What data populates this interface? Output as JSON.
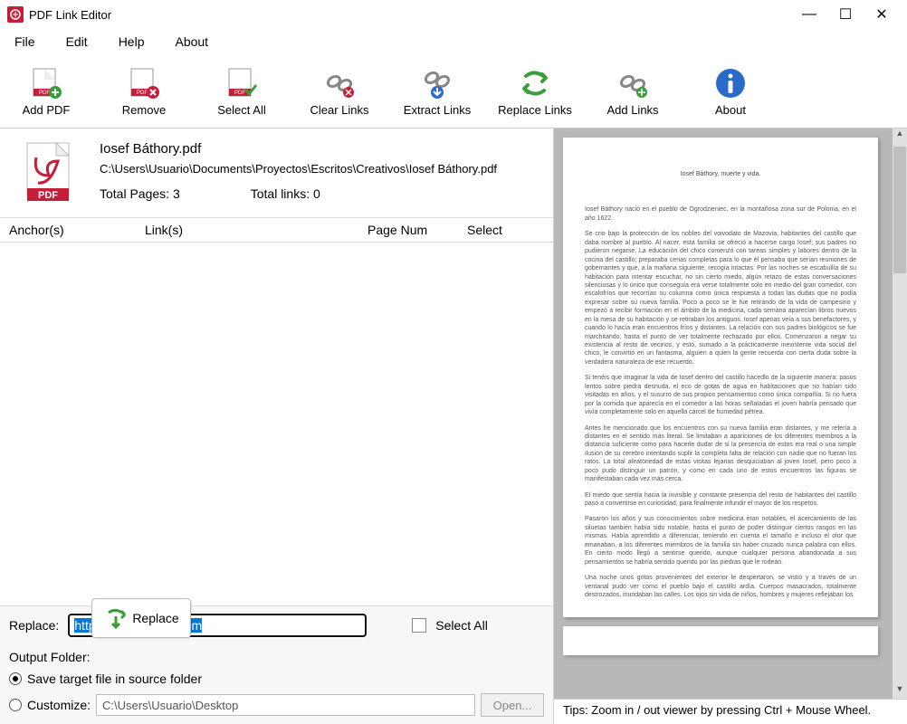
{
  "window": {
    "title": "PDF Link Editor"
  },
  "menu": {
    "file": "File",
    "edit": "Edit",
    "help": "Help",
    "about": "About"
  },
  "toolbar": {
    "add_pdf": "Add PDF",
    "remove": "Remove",
    "select_all": "Select All",
    "clear_links": "Clear Links",
    "extract_links": "Extract Links",
    "replace_links": "Replace Links",
    "add_links": "Add Links",
    "about": "About"
  },
  "file": {
    "name": "Iosef Báthory.pdf",
    "path": "C:\\Users\\Usuario\\Documents\\Proyectos\\Escritos\\Creativos\\Iosef Báthory.pdf",
    "total_pages": "Total Pages: 3",
    "total_links": "Total links: 0"
  },
  "table": {
    "anchor": "Anchor(s)",
    "link": "Link(s)",
    "page_num": "Page Num",
    "select": "Select"
  },
  "replace": {
    "label": "Replace:",
    "value": "http://www.google.com",
    "select_all": "Select All",
    "button": "Replace"
  },
  "output": {
    "label": "Output Folder:",
    "source": "Save target file in source folder",
    "customize": "Customize:",
    "custom_path": "C:\\Users\\Usuario\\Desktop",
    "open": "Open..."
  },
  "preview": {
    "title": "Iosef Báthory, muerte y vida.",
    "p1": "Iosef Báthory nació en el pueblo de Ogrodzieniec, en la montañosa zona sur de Polonia, en el año 1622.",
    "p2": "Se crio bajo la protección de los nobles del voivodato de Mazovia, habitantes del castillo que daba nombre al pueblo. Al nacer, esta familia se ofreció a hacerse cargo Iosef; sus padres no pudieron negarse. La educación del chico comenzó con tareas simples y labores dentro de la cocina del castillo; preparaba cenas completas para lo que él pensaba que serían reuniones de gobernantes y que, a la mañana siguiente, recogía intactas. Por las noches se escabullía de su habitación para intentar escuchar, no sin cierto miedo, algún retazo de estas conversaciones silenciosas y lo único que conseguía era verse totalmente solo en medio del gran comedor, con escalofríos que recorrían su columna como única respuesta a todas las dudas que no podía expresar sobre su nueva familia. Poco a poco se le fue retirando de la vida de campesino y empezó a recibir formación en el ámbito de la medicina, cada semana aparecían libros nuevos en la mesa de su habitación y se retiraban los antiguos. Iosef apenas veía a sus benefactores, y cuando lo hacía eran encuentros fríos y distantes. La relación con sus padres biológicos se fue marchitando, hasta el punto de ver totalmente rechazado por ellos. Comenzaron a negar su existencia al resto de vecinos, y esto, sumado a la prácticamente inexistente vida social del chico, le convirtió en un fantasma, alguien a quien la gente recuerda con cierta duda sobre la verdadera naturaleza de ese recuerdo.",
    "p3": "Si tenéis que imaginar la vida de Iosef dentro del castillo hacedlo de la siguiente manera: pasos lentos sobre piedra desnuda, el eco de gotas de agua en habitaciones que no habían sido visitadas en años, y el susurro de sus propios pensamientos como única compañía. Si no fuera por la comida que aparecía en el comedor a las horas señaladas el joven habría pensado que vivía completamente solo en aquella cárcel de humedad pétrea.",
    "p4": "Antes he mencionado que los encuentros con su nueva familia eran distantes, y me refería a distantes en el sentido más literal. Se limitaban a apariciones de los diferentes miembros a la distancia suficiente como para hacerle dudar de si la presencia de estos era real o una simple ilusión de su cerebro intentando suplir la completa falta de relación con nadie que no fueran los ratos. La total aleatoriedad de estas visitas lejanas desquiciaban al joven Iosef, pero poco a poco pudo distinguir un patrón, y como en cada uno de estos encuentros las figuras se manifestaban cada vez más cerca.",
    "p5": "El miedo que sentía hacia la invisible y constante presencia del resto de habitantes del castillo pasó a convertirse en curiosidad, para finalmente infundir el mayor de los respetos.",
    "p6": "Pasaron los años y sus conocimientos sobre medicina eran notables, el acercamiento de las siluetas también había sido notable, hasta el punto de poder distinguir ciertos rasgos en las mismas. Había aprendido a diferenciar, teniendo en cuenta el tamaño e incluso el olor que emanaban, a los diferentes miembros de la familia sin haber cruzado nunca palabra con ellos. En cierto modo llegó a sentirse querido, aunque cualquier persona abandonada a sus pensamientos se habría sentido querido por las piedras que le rodean.",
    "p7": "Una noche unos gritos provenientes del exterior le despertaron, se vistió y a través de un ventanal pudo ver como el pueblo bajo el castillo ardía. Cuerpos masacrados, totalmente destrozados, inundaban las calles. Los ojos sin vida de niños, hombres y mujeres reflejaban los"
  },
  "tips": "Tips: Zoom in / out viewer by pressing Ctrl + Mouse Wheel."
}
